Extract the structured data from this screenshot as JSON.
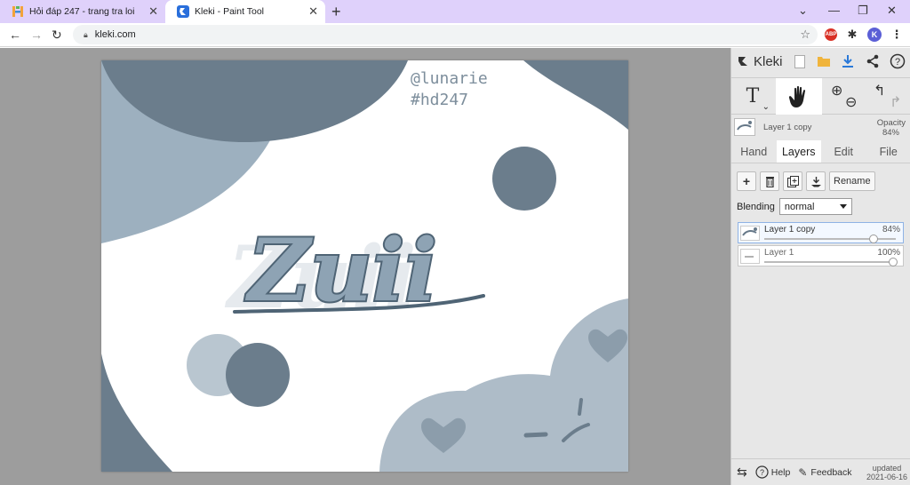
{
  "browser": {
    "tabs": [
      {
        "title": "Hỏi đáp 247 - trang tra loi",
        "favicon": "hoidap-favicon-icon",
        "active": false
      },
      {
        "title": "Kleki - Paint Tool",
        "favicon": "kleki-favicon-icon",
        "active": true
      }
    ],
    "new_tab": "+",
    "url": "kleki.com",
    "profile_initial": "K",
    "abp_label": "ABP"
  },
  "canvas": {
    "watermark_handle": "@lunarie",
    "watermark_tag": "#hd247",
    "artwork_text": "Zuii",
    "colors": {
      "dark": "#667888",
      "medium": "#90a3b1",
      "light": "#b8c6d1",
      "bg": "#ffffff"
    }
  },
  "sidebar": {
    "logo": "Kleki",
    "tool_text_label": "T",
    "layer_label": "Layer 1 copy",
    "opacity_label": "Opacity",
    "opacity_value": "84%",
    "tabs": [
      "Hand",
      "Layers",
      "Edit",
      "File"
    ],
    "active_tab": "Layers",
    "rename_label": "Rename",
    "blending_label": "Blending",
    "blending_value": "normal",
    "layers": [
      {
        "name": "Layer 1 copy",
        "opacity": "84%",
        "opacity_fraction": 0.84,
        "selected": true
      },
      {
        "name": "Layer 1",
        "opacity": "100%",
        "opacity_fraction": 1.0,
        "selected": false
      }
    ],
    "bottom": {
      "help": "Help",
      "feedback": "Feedback",
      "updated_label": "updated",
      "updated_date": "2021-06-16"
    }
  }
}
